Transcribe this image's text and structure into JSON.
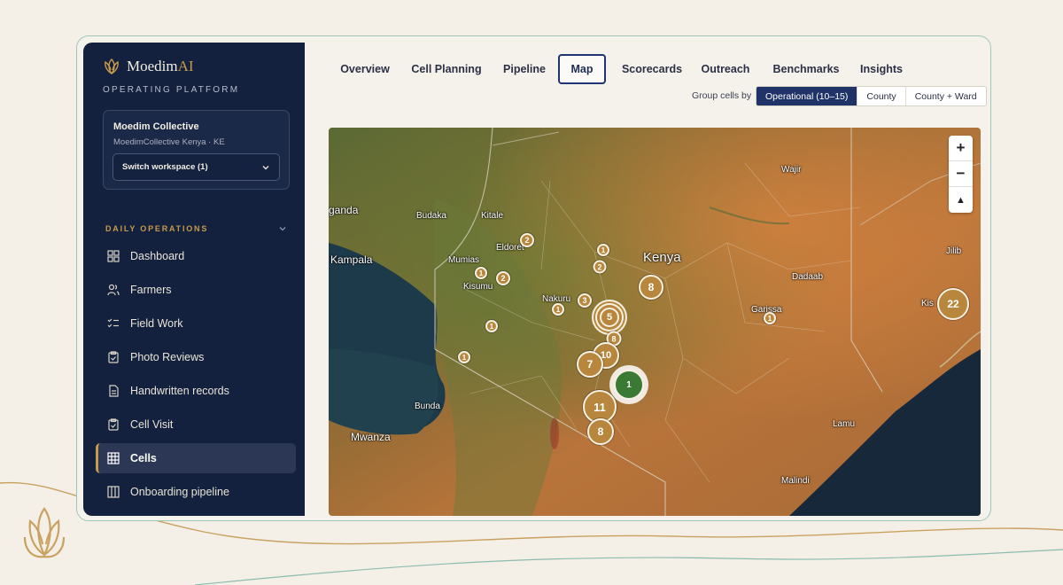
{
  "brand": {
    "name_main": "Moedim",
    "name_accent": "AI",
    "subtitle": "OPERATING PLATFORM"
  },
  "workspace": {
    "name": "Moedim Collective",
    "detail": "MoedimCollective Kenya · KE",
    "switch_label": "Switch workspace (1)"
  },
  "sidebar": {
    "section_label": "DAILY OPERATIONS",
    "items": [
      {
        "label": "Dashboard",
        "icon": "dashboard-icon",
        "active": false
      },
      {
        "label": "Farmers",
        "icon": "users-icon",
        "active": false
      },
      {
        "label": "Field Work",
        "icon": "checklist-icon",
        "active": false
      },
      {
        "label": "Photo Reviews",
        "icon": "clipboard-icon",
        "active": false
      },
      {
        "label": "Handwritten records",
        "icon": "document-icon",
        "active": false
      },
      {
        "label": "Cell Visit",
        "icon": "clipboard-check-icon",
        "active": false
      },
      {
        "label": "Cells",
        "icon": "grid-icon",
        "active": true
      },
      {
        "label": "Onboarding pipeline",
        "icon": "columns-icon",
        "active": false
      }
    ]
  },
  "tabs": [
    {
      "label": "Overview",
      "active": false
    },
    {
      "label": "Cell Planning",
      "active": false
    },
    {
      "label": "Pipeline",
      "active": false
    },
    {
      "label": "Map",
      "active": true
    },
    {
      "label": "Scorecards",
      "active": false
    },
    {
      "label": "Outreach",
      "active": false
    },
    {
      "label": "Benchmarks",
      "active": false
    },
    {
      "label": "Insights",
      "active": false
    }
  ],
  "grouping": {
    "label": "Group cells by",
    "options": [
      "Operational (10–15)",
      "County",
      "County + Ward"
    ],
    "selected": "Operational (10–15)"
  },
  "map": {
    "zoom_in": "+",
    "zoom_out": "−",
    "compass": "▲",
    "places": [
      "ganda",
      "Budaka",
      "Kitale",
      "Eldoret",
      "Mumias",
      "Kampala",
      "Kisumu",
      "Nakuru",
      "Kenya",
      "Wajir",
      "Dadaab",
      "Garissa",
      "Jilib",
      "Kis",
      "Bunda",
      "Mwanza",
      "Lamu",
      "Malindi"
    ],
    "clusters": [
      {
        "count": "2",
        "color": "gold"
      },
      {
        "count": "1",
        "color": "gold"
      },
      {
        "count": "2",
        "color": "gold"
      },
      {
        "count": "1",
        "color": "gold"
      },
      {
        "count": "2",
        "color": "gold"
      },
      {
        "count": "8",
        "color": "gold"
      },
      {
        "count": "3",
        "color": "gold"
      },
      {
        "count": "1",
        "color": "gold"
      },
      {
        "count": "5",
        "color": "gold"
      },
      {
        "count": "1",
        "color": "gold"
      },
      {
        "count": "8",
        "color": "gold"
      },
      {
        "count": "1",
        "color": "gold"
      },
      {
        "count": "10",
        "color": "gold"
      },
      {
        "count": "7",
        "color": "gold"
      },
      {
        "count": "1",
        "color": "green"
      },
      {
        "count": "11",
        "color": "gold"
      },
      {
        "count": "8",
        "color": "gold"
      },
      {
        "count": "1",
        "color": "gold"
      },
      {
        "count": "22",
        "color": "gold"
      }
    ]
  },
  "colors": {
    "sidebar": "#13213f",
    "accent_gold": "#c89a4a",
    "active_tab": "#1d3570",
    "cluster_gold": "#b8873d",
    "cluster_green": "#3a7a34"
  }
}
